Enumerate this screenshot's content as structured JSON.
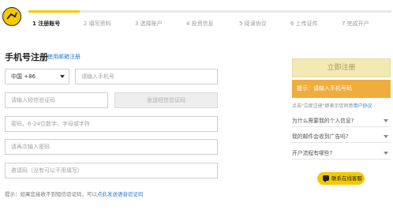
{
  "brand": {
    "accent": "#f5c900",
    "link": "#2a7bd3",
    "alert": "#f0ac3c"
  },
  "steps": [
    {
      "label": "1 注册账号",
      "active": true
    },
    {
      "label": "2 填写资料",
      "active": false
    },
    {
      "label": "3 选择账户",
      "active": false
    },
    {
      "label": "4 投资信息",
      "active": false
    },
    {
      "label": "5 阅读协议",
      "active": false
    },
    {
      "label": "6 上传证件",
      "active": false
    },
    {
      "label": "7 完成开户",
      "active": false
    }
  ],
  "heading": "手机号注册",
  "email_link": "使用邮箱注册",
  "form": {
    "country_value": "中国 +86",
    "phone_placeholder": "请输入手机号",
    "code_placeholder": "请输入短信验证码",
    "send_code_label": "发送短信验证码",
    "password_placeholder": "密码，6-24位数字、字母或字符",
    "password_confirm_placeholder": "请再次输入密码",
    "invite_placeholder": "邀请码（没有可以不用填写）"
  },
  "tip": {
    "text": "提示：如果您接收不到短信验证码，可以",
    "link": "点此发送语音验证码"
  },
  "register_label": "立即注册",
  "alert_text": "提示：请输入手机号码",
  "agree": {
    "text": "点击\"立即注册\"即表示您同意",
    "link": "用户协议"
  },
  "faq": [
    "为什么需要我的个人信息?",
    "我的邮件会收到广告吗?",
    "开户流程有哪些?"
  ],
  "service_label": "联系在线客服"
}
